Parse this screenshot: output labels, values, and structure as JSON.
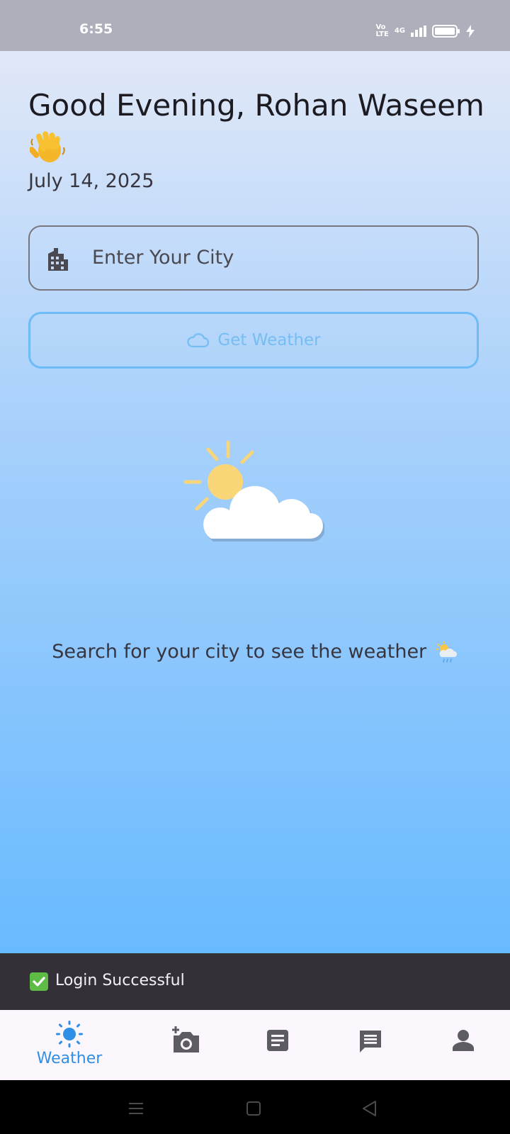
{
  "status_bar": {
    "time": "6:55",
    "volte_label": "Vo\nLTE",
    "network_label": "4G"
  },
  "header": {
    "greeting": "Good Evening, Rohan Waseem",
    "greeting_emoji_icon": "waving-hand-icon",
    "date": "July 14, 2025"
  },
  "search": {
    "placeholder": "Enter Your City",
    "icon": "city-building-icon",
    "value": ""
  },
  "get_weather_button": {
    "label": "Get Weather",
    "icon": "cloud-outline-icon"
  },
  "hero": {
    "icon": "sun-behind-cloud-icon"
  },
  "hint": {
    "text": "Search for your city to see the weather",
    "icon": "sun-behind-rain-cloud-icon"
  },
  "snackbar": {
    "text": "Login Successful",
    "icon": "check-mark-icon"
  },
  "bottom_nav": {
    "items": [
      {
        "label": "Weather",
        "icon": "sun-icon",
        "active": true
      },
      {
        "label": "",
        "icon": "add-photo-camera-icon",
        "active": false
      },
      {
        "label": "",
        "icon": "notes-icon",
        "active": false
      },
      {
        "label": "",
        "icon": "chat-icon",
        "active": false
      },
      {
        "label": "",
        "icon": "person-icon",
        "active": false
      }
    ]
  },
  "colors": {
    "accent": "#2f8ee6",
    "button_border": "#6dbbf7",
    "snackbar_bg": "#333137"
  }
}
